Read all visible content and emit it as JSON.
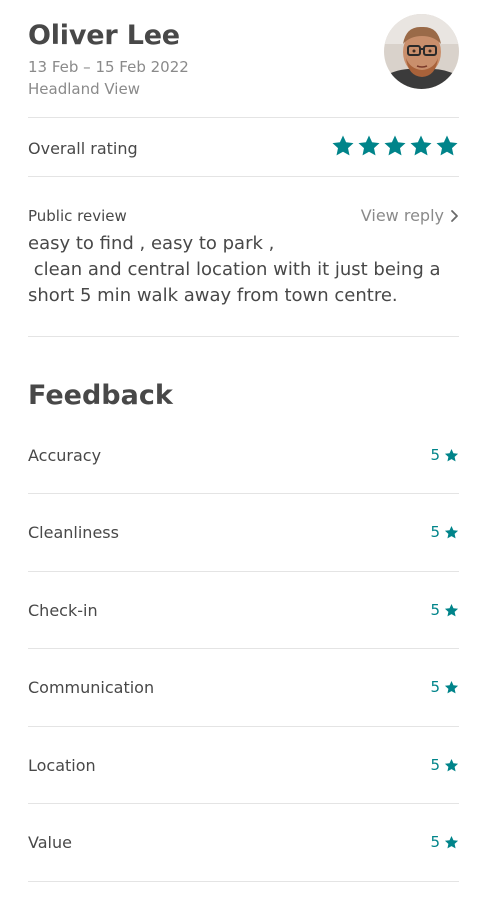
{
  "header": {
    "guest_name": "Oliver Lee",
    "dates": "13 Feb – 15 Feb 2022",
    "listing": "Headland View"
  },
  "overall": {
    "label": "Overall rating",
    "stars": 5
  },
  "review": {
    "title": "Public review",
    "view_reply": "View reply",
    "lines": [
      "easy to find , easy to park ,",
      " clean and central location with it just being a",
      "short 5 min walk away from town centre."
    ]
  },
  "feedback": {
    "title": "Feedback",
    "items": [
      {
        "label": "Accuracy",
        "score": "5"
      },
      {
        "label": "Cleanliness",
        "score": "5"
      },
      {
        "label": "Check-in",
        "score": "5"
      },
      {
        "label": "Communication",
        "score": "5"
      },
      {
        "label": "Location",
        "score": "5"
      },
      {
        "label": "Value",
        "score": "5"
      }
    ]
  },
  "colors": {
    "accent": "#00848a",
    "text": "#484848",
    "muted": "#8a8a8a",
    "divider": "#e4e4e4"
  },
  "icons": {
    "star": "star-icon",
    "chevron": "chevron-right-icon"
  }
}
